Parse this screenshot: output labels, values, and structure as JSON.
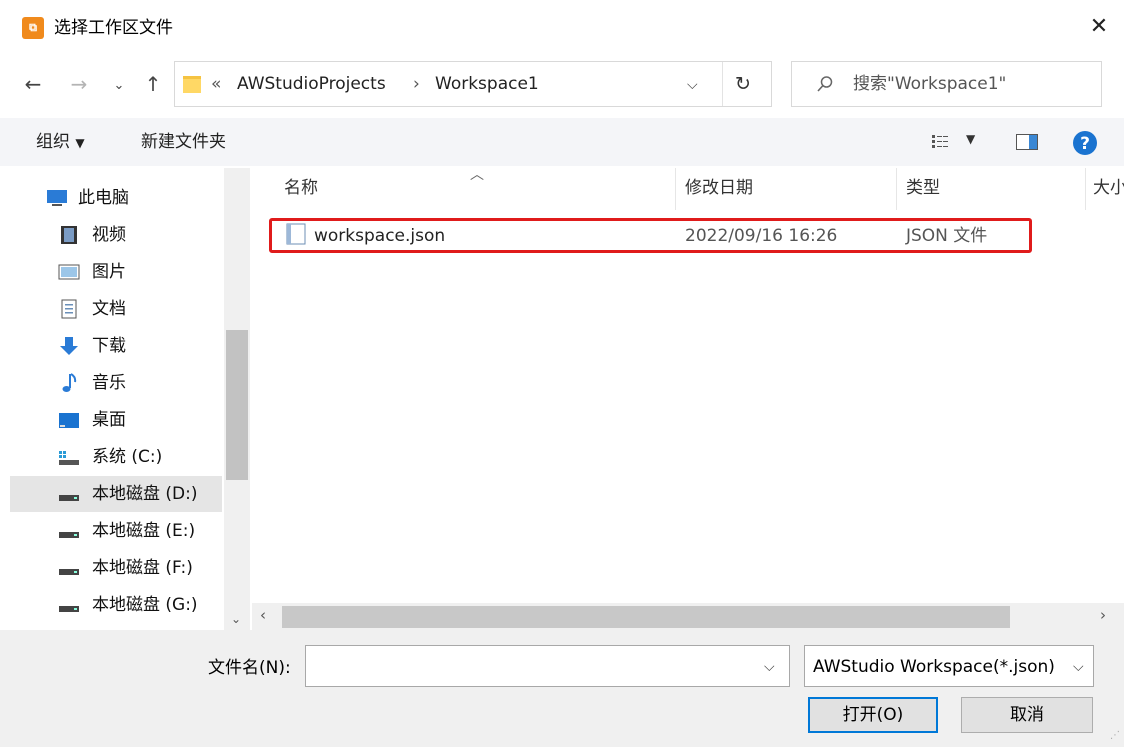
{
  "window": {
    "title": "选择工作区文件"
  },
  "nav": {
    "breadcrumb": [
      "«",
      "AWStudioProjects",
      "›",
      "Workspace1"
    ],
    "search_placeholder": "搜索\"Workspace1\""
  },
  "toolbar": {
    "organize": "组织",
    "new_folder": "新建文件夹"
  },
  "sidebar": {
    "items": [
      {
        "label": "此电脑",
        "icon": "computer-icon"
      },
      {
        "label": "视频",
        "icon": "video-icon"
      },
      {
        "label": "图片",
        "icon": "picture-icon"
      },
      {
        "label": "文档",
        "icon": "document-icon"
      },
      {
        "label": "下载",
        "icon": "download-icon"
      },
      {
        "label": "音乐",
        "icon": "music-icon"
      },
      {
        "label": "桌面",
        "icon": "desktop-icon"
      },
      {
        "label": "系统 (C:)",
        "icon": "system-drive-icon"
      },
      {
        "label": "本地磁盘 (D:)",
        "icon": "drive-icon",
        "selected": true
      },
      {
        "label": "本地磁盘 (E:)",
        "icon": "drive-icon"
      },
      {
        "label": "本地磁盘 (F:)",
        "icon": "drive-icon"
      },
      {
        "label": "本地磁盘 (G:)",
        "icon": "drive-icon"
      }
    ]
  },
  "file_list": {
    "columns": [
      "名称",
      "修改日期",
      "类型",
      "大小"
    ],
    "rows": [
      {
        "name": "workspace.json",
        "modified": "2022/09/16 16:26",
        "type": "JSON 文件"
      }
    ]
  },
  "footer": {
    "filename_label": "文件名(N):",
    "filename_value": "",
    "filetype_value": "AWStudio Workspace(*.json)",
    "open_button": "打开(O)",
    "cancel_button": "取消"
  },
  "colors": {
    "highlight": "#e01b1b",
    "accent": "#0078d7",
    "folder": "#f5c342"
  }
}
